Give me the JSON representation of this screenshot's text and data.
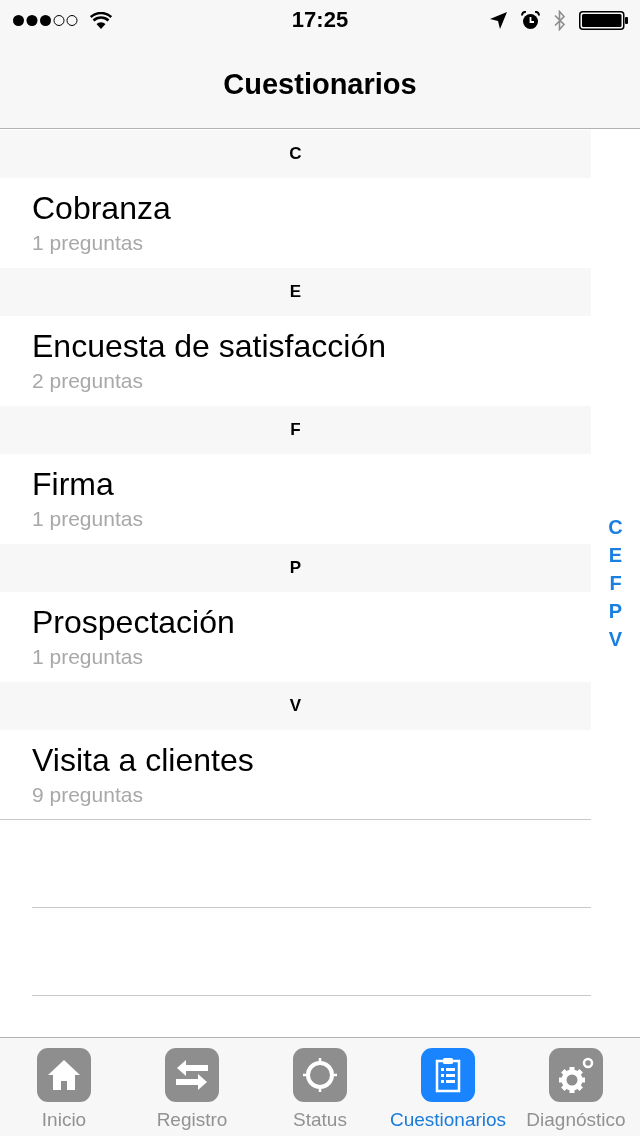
{
  "status_bar": {
    "time": "17:25"
  },
  "nav_bar": {
    "title": "Cuestionarios"
  },
  "sections": [
    {
      "header": "C",
      "items": [
        {
          "title": "Cobranza",
          "subtitle": "1 preguntas"
        }
      ]
    },
    {
      "header": "E",
      "items": [
        {
          "title": "Encuesta de satisfacción",
          "subtitle": "2 preguntas"
        }
      ]
    },
    {
      "header": "F",
      "items": [
        {
          "title": "Firma",
          "subtitle": "1 preguntas"
        }
      ]
    },
    {
      "header": "P",
      "items": [
        {
          "title": "Prospectación",
          "subtitle": "1 preguntas"
        }
      ]
    },
    {
      "header": "V",
      "items": [
        {
          "title": "Visita a clientes",
          "subtitle": "9 preguntas"
        }
      ]
    }
  ],
  "section_index": [
    "C",
    "E",
    "F",
    "P",
    "V"
  ],
  "tab_bar": [
    {
      "label": "Inicio",
      "kind": "home",
      "selected": false
    },
    {
      "label": "Registro",
      "kind": "transfer",
      "selected": false
    },
    {
      "label": "Status",
      "kind": "target",
      "selected": false
    },
    {
      "label": "Cuestionarios",
      "kind": "clipboard",
      "selected": true
    },
    {
      "label": "Diagnóstico",
      "kind": "gears",
      "selected": false
    }
  ]
}
